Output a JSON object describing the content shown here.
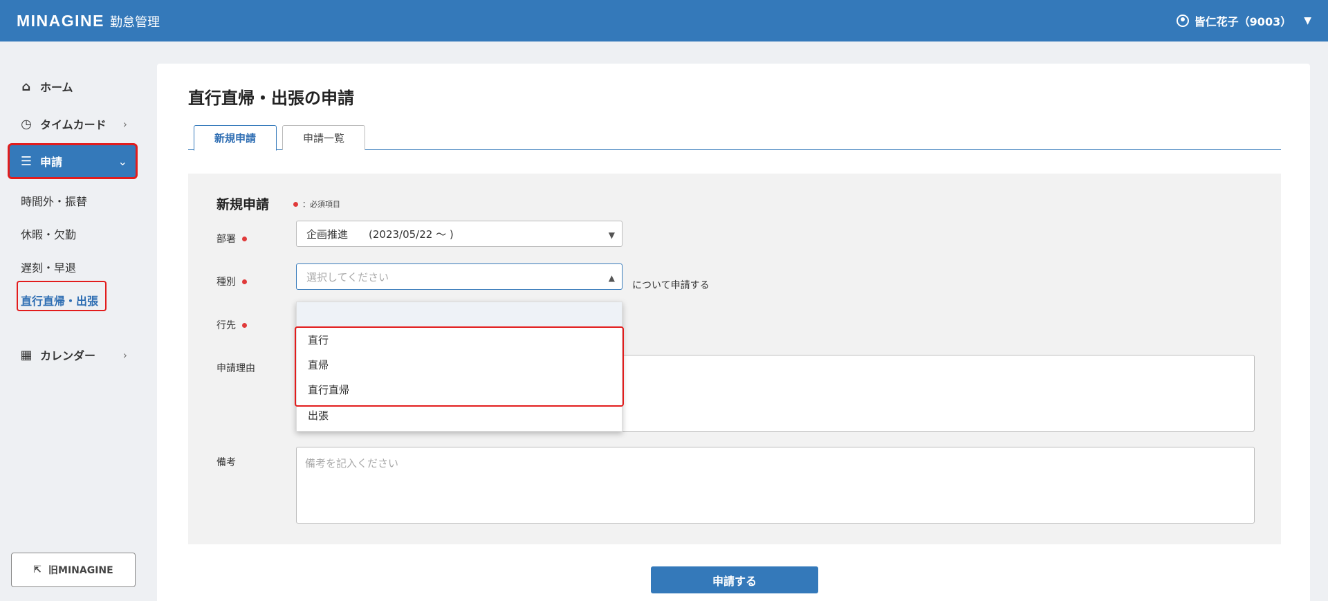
{
  "header": {
    "logo": "MINAGINE",
    "app_name": "勤怠管理",
    "user_name": "皆仁花子（9003）",
    "user_icon": "user-circle-icon",
    "menu_caret": "▼"
  },
  "sidebar": {
    "home": "ホーム",
    "timecard": "タイムカード",
    "application": "申請",
    "sub_items": [
      "時間外・振替",
      "休暇・欠勤",
      "遅刻・早退",
      "直行直帰・出張"
    ],
    "calendar": "カレンダー",
    "old_link": "旧MINAGINE",
    "highlight_color": "#e21c1c"
  },
  "main": {
    "title": "直行直帰・出張の申請",
    "tabs": [
      "新規申請",
      "申請一覧"
    ],
    "form": {
      "title": "新規申請",
      "required_legend": "：必須項目",
      "department_label": "部署",
      "department_value": "企画推進　　(2023/05/22 〜 )",
      "type_label": "種別",
      "type_placeholder": "選択してください",
      "type_suffix": "について申請する",
      "destination_label": "行先",
      "reason_label": "申請理由",
      "notes_label": "備考",
      "notes_placeholder": "備考を記入ください",
      "type_options": [
        "",
        "直行",
        "直帰",
        "直行直帰",
        "出張"
      ]
    },
    "submit_label": "申請する"
  },
  "colors": {
    "primary": "#3479ba",
    "required_dot": "#e03a3a",
    "highlight": "#e21c1c"
  }
}
